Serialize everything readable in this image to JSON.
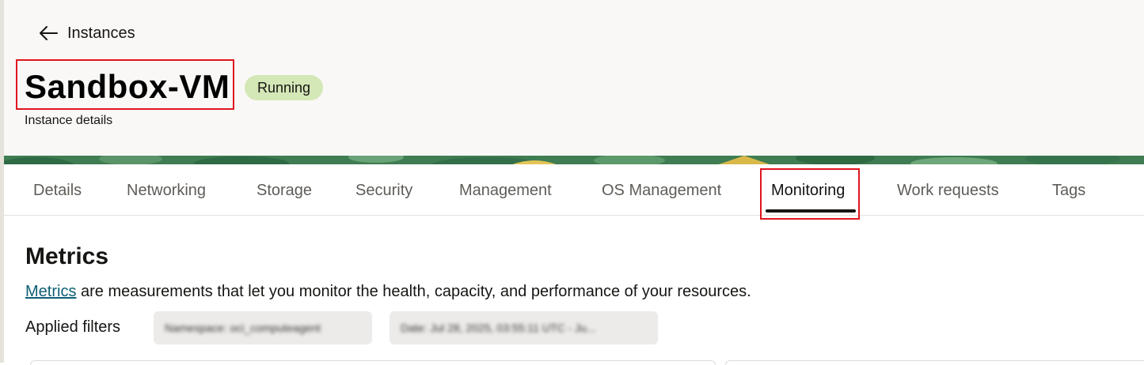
{
  "breadcrumb": {
    "back_label": "Instances"
  },
  "instance": {
    "name": "Sandbox-VM",
    "status": "Running",
    "subtitle": "Instance details"
  },
  "tabs": [
    {
      "label": "Details"
    },
    {
      "label": "Networking"
    },
    {
      "label": "Storage"
    },
    {
      "label": "Security"
    },
    {
      "label": "Management"
    },
    {
      "label": "OS Management"
    },
    {
      "label": "Monitoring",
      "active": true
    },
    {
      "label": "Work requests"
    },
    {
      "label": "Tags"
    }
  ],
  "metrics": {
    "title": "Metrics",
    "link_text": "Metrics",
    "description_rest": " are measurements that let you monitor the health, capacity, and performance of your resources.",
    "filters_label": "Applied filters",
    "filters": [
      {
        "text": "Namespace: oci_computeagent"
      },
      {
        "text": "Date: Jul 28, 2025, 03:55:11 UTC - Ju..."
      }
    ]
  },
  "colors": {
    "status_badge_bg": "#d4e7b6",
    "highlight_border": "#e0141e",
    "link": "#0e5e73",
    "banner_green": "#3f7d52"
  },
  "icons": {
    "back": "arrow-left-icon"
  }
}
